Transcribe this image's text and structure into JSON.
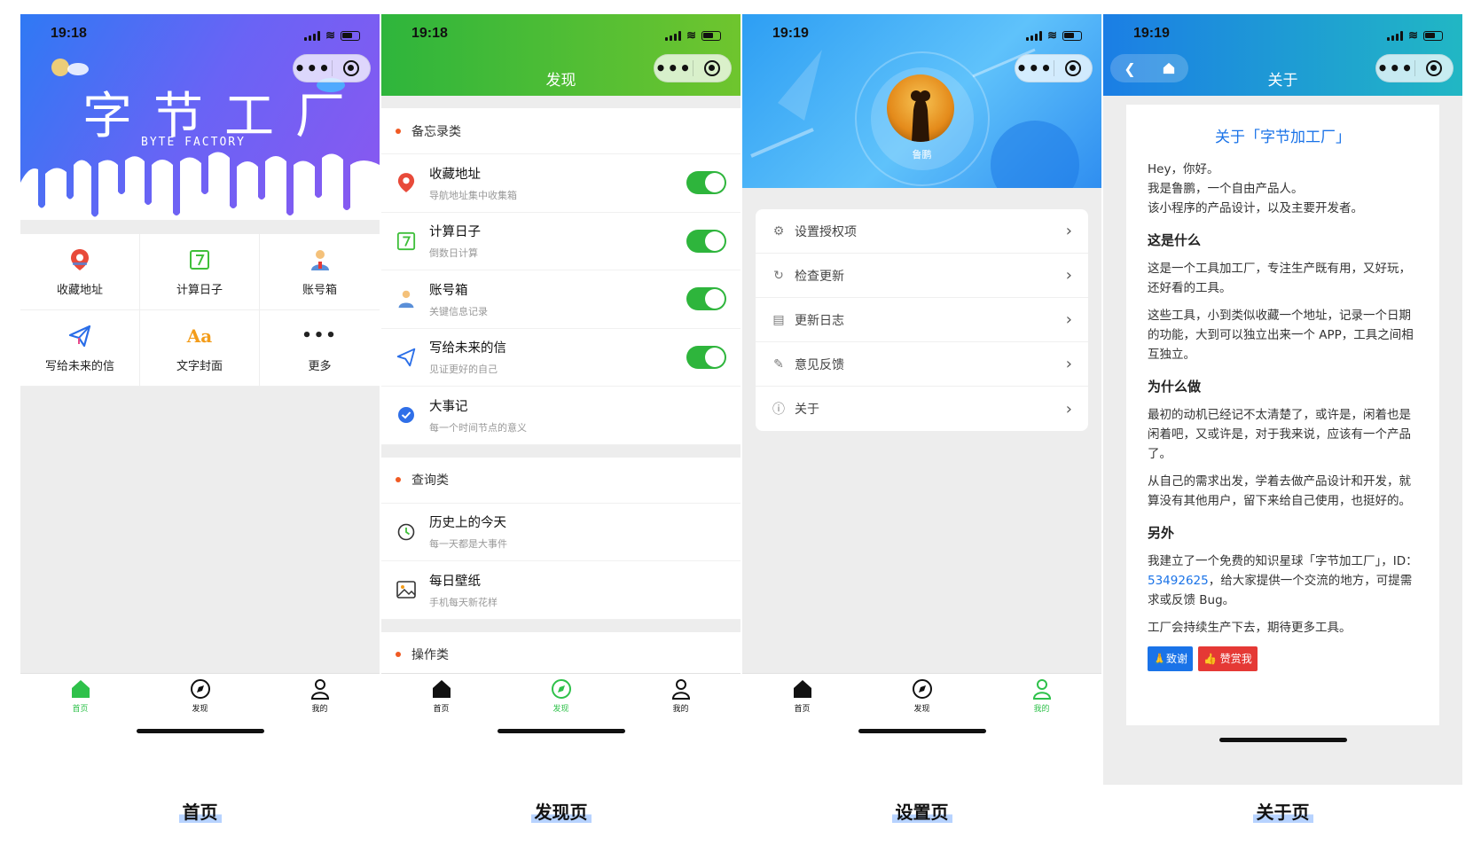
{
  "screens": {
    "home": {
      "time": "19:18",
      "hero_title": "字节工厂",
      "hero_subtitle": "BYTE FACTORY",
      "grid": [
        {
          "label": "收藏地址",
          "icon": "map-pin-icon"
        },
        {
          "label": "计算日子",
          "icon": "calendar-seven-icon"
        },
        {
          "label": "账号箱",
          "icon": "person-icon"
        },
        {
          "label": "写给未来的信",
          "icon": "paper-plane-icon"
        },
        {
          "label": "文字封面",
          "icon": "text-aa-icon",
          "glyph": "Aa"
        },
        {
          "label": "更多",
          "icon": "more-dots-icon",
          "glyph": "•••"
        }
      ]
    },
    "discover": {
      "time": "19:18",
      "title": "发现",
      "sections": [
        {
          "name": "备忘录类",
          "items": [
            {
              "title": "收藏地址",
              "sub": "导航地址集中收集箱",
              "toggle": true
            },
            {
              "title": "计算日子",
              "sub": "倒数日计算",
              "toggle": true
            },
            {
              "title": "账号箱",
              "sub": "关键信息记录",
              "toggle": true
            },
            {
              "title": "写给未来的信",
              "sub": "见证更好的自己",
              "toggle": true
            },
            {
              "title": "大事记",
              "sub": "每一个时间节点的意义",
              "toggle": false
            }
          ]
        },
        {
          "name": "查询类",
          "items": [
            {
              "title": "历史上的今天",
              "sub": "每一天都是大事件"
            },
            {
              "title": "每日壁纸",
              "sub": "手机每天新花样"
            }
          ]
        },
        {
          "name": "操作类",
          "items": []
        }
      ]
    },
    "settings": {
      "time": "19:19",
      "user_name": "鲁鹏",
      "rows": [
        {
          "label": "设置授权项",
          "icon": "gear-icon",
          "glyph": "⚙"
        },
        {
          "label": "检查更新",
          "icon": "refresh-icon",
          "glyph": "↻"
        },
        {
          "label": "更新日志",
          "icon": "log-icon",
          "glyph": "▤"
        },
        {
          "label": "意见反馈",
          "icon": "pencil-icon",
          "glyph": "✎"
        },
        {
          "label": "关于",
          "icon": "info-icon",
          "glyph": "ⓘ"
        }
      ]
    },
    "about": {
      "time": "19:19",
      "title": "关于",
      "heading": "关于「字节加工厂」",
      "intro": [
        "Hey，你好。",
        "我是鲁鹏，一个自由产品人。",
        "该小程序的产品设计，以及主要开发者。"
      ],
      "what_title": "这是什么",
      "what_p1": "这是一个工具加工厂，专注生产既有用，又好玩，还好看的工具。",
      "what_p2": "这些工具，小到类似收藏一个地址，记录一个日期的功能，大到可以独立出来一个 APP，工具之间相互独立。",
      "why_title": "为什么做",
      "why_p1": "最初的动机已经记不太清楚了，或许是，闲着也是闲着吧，又或许是，对于我来说，应该有一个产品了。",
      "why_p2": "从自己的需求出发，学着去做产品设计和开发，就算没有其他用户，留下来给自己使用，也挺好的。",
      "extra_title": "另外",
      "extra_p1_a": "我建立了一个免费的知识星球「字节加工厂」，ID：",
      "extra_p1_id": "53492625",
      "extra_p1_b": "，给大家提供一个交流的地方，可提需求或反馈 Bug。",
      "extra_p2": "工厂会持续生产下去，期待更多工具。",
      "btn_thanks": "🙏致谢",
      "btn_reward": "👍 赞赏我"
    }
  },
  "tabbar": {
    "home": "首页",
    "discover": "发现",
    "mine": "我的"
  },
  "captions": [
    "首页",
    "发现页",
    "设置页",
    "关于页"
  ],
  "colors": {
    "green": "#2eb53c",
    "accent_orange": "#f05a23",
    "link_blue": "#1a73e8",
    "red": "#e53935"
  }
}
